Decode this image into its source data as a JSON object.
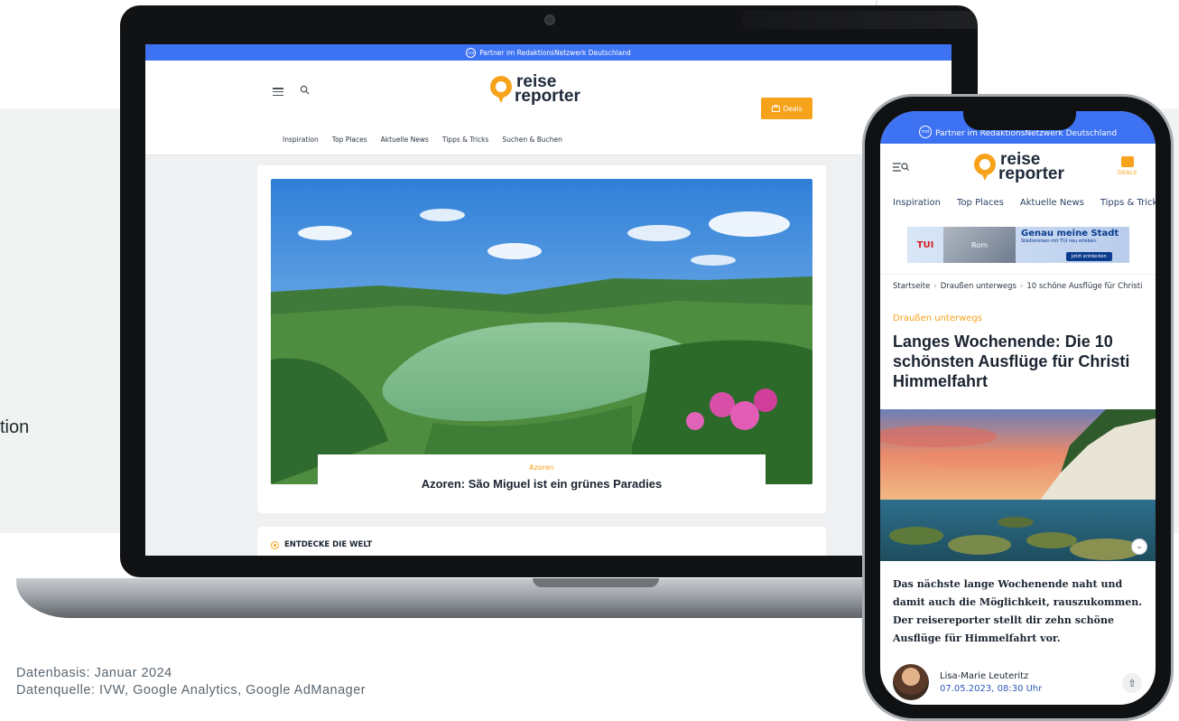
{
  "side_text": "tion",
  "laptop": {
    "partner_bar": {
      "logo": "rnd",
      "text": "Partner im RedaktionsNetzwerk Deutschland"
    },
    "header": {
      "menu_icon": "hamburger-icon",
      "search_icon": "search-icon",
      "logo_line1": "reise",
      "logo_line2": "reporter",
      "deals_label": "Deals"
    },
    "nav": [
      "Inspiration",
      "Top Places",
      "Aktuelle News",
      "Tipps & Tricks",
      "Suchen & Buchen"
    ],
    "hero": {
      "kicker": "Azoren",
      "title": "Azoren: São Miguel ist ein grünes Paradies"
    },
    "discover_label": "ENTDECKE DIE WELT"
  },
  "phone": {
    "partner_bar": {
      "logo": "rnd",
      "text": "Partner im RedaktionsNetzwerk Deutschland"
    },
    "header": {
      "logo_line1": "reise",
      "logo_line2": "reporter",
      "deals_label": "DEALS"
    },
    "nav": [
      "Inspiration",
      "Top Places",
      "Aktuelle News",
      "Tipps & Tricks"
    ],
    "ad": {
      "brand": "TUI",
      "image_label": "Rom",
      "headline": "Genau meine Stadt",
      "sub": "Städtereisen mit TUI neu erleben.",
      "cta": "Jetzt entdecken"
    },
    "breadcrumb": [
      "Startseite",
      "Draußen unterwegs",
      "10 schöne Ausflüge für Christi"
    ],
    "article": {
      "kicker": "Draußen unterwegs",
      "title": "Langes Wochenende: Die 10 schönsten Ausflüge für Christi Himmelfahrt",
      "lead": "Das nächste lange Wochenende naht und damit auch die Möglichkeit, rauszukommen. Der reisereporter stellt dir zehn schöne Ausflüge für Himmelfahrt vor.",
      "author_name": "Lisa-Marie Leuteritz",
      "date": "07.05.2023, 08:30 Uhr"
    }
  },
  "footnote": {
    "line1": "Datenbasis: Januar 2024",
    "line2": "Datenquelle: IVW, Google Analytics, Google AdManager"
  },
  "colors": {
    "accent": "#f7a21b",
    "brand_blue": "#3d72f2",
    "text_dark": "#1b2430"
  }
}
